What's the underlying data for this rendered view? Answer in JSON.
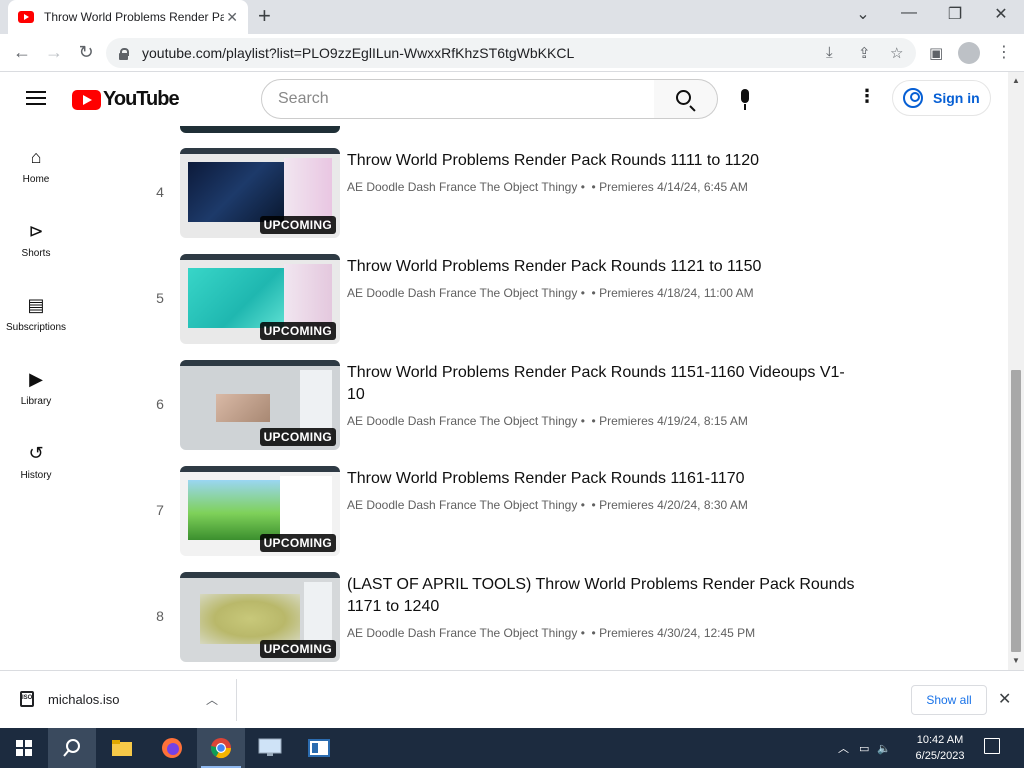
{
  "browser": {
    "tab_title": "Throw World Problems Render Pack",
    "url": "youtube.com/playlist?list=PLO9zzEglILun-WwxxRfKhzST6tgWbKKCL",
    "new_tab": "+",
    "minimize": "⌄",
    "min": "—",
    "restore": "❐",
    "close": "✕"
  },
  "youtube": {
    "logo_text": "YouTube",
    "search_placeholder": "Search",
    "sign_in": "Sign in"
  },
  "nav": {
    "items": [
      {
        "label": "Home",
        "icon": "home-icon"
      },
      {
        "label": "Shorts",
        "icon": "shorts-icon"
      },
      {
        "label": "Subscriptions",
        "icon": "subscriptions-icon"
      },
      {
        "label": "Library",
        "icon": "library-icon"
      },
      {
        "label": "History",
        "icon": "history-icon"
      }
    ]
  },
  "playlist": {
    "badge": "UPCOMING",
    "items": [
      {
        "index": "4",
        "title": "Throw World Problems Render Pack Rounds 1111 to 1120",
        "channel": "AE Doodle Dash France The Object Thingy",
        "premiere": "Premieres 4/14/24, 6:45 AM"
      },
      {
        "index": "5",
        "title": "Throw World Problems Render Pack Rounds 1121 to 1150",
        "channel": "AE Doodle Dash France The Object Thingy",
        "premiere": "Premieres 4/18/24, 11:00 AM"
      },
      {
        "index": "6",
        "title": "Throw World Problems Render Pack Rounds 1151-1160 Videoups V1-10",
        "channel": "AE Doodle Dash France The Object Thingy",
        "premiere": "Premieres 4/19/24, 8:15 AM"
      },
      {
        "index": "7",
        "title": "Throw World Problems Render Pack Rounds 1161-1170",
        "channel": "AE Doodle Dash France The Object Thingy",
        "premiere": "Premieres 4/20/24, 8:30 AM"
      },
      {
        "index": "8",
        "title": "(LAST OF APRIL TOOLS) Throw World Problems Render Pack Rounds 1171 to 1240",
        "channel": "AE Doodle Dash France The Object Thingy",
        "premiere": "Premieres 4/30/24, 12:45 PM"
      }
    ]
  },
  "download": {
    "filename": "michalos.iso",
    "file_badge": "ISO",
    "show_all": "Show all"
  },
  "taskbar": {
    "time": "10:42 AM",
    "date": "6/25/2023"
  },
  "colors": {
    "youtube_red": "#ff0000",
    "link_blue": "#065fd4",
    "taskbar": "#1c2b3f"
  }
}
